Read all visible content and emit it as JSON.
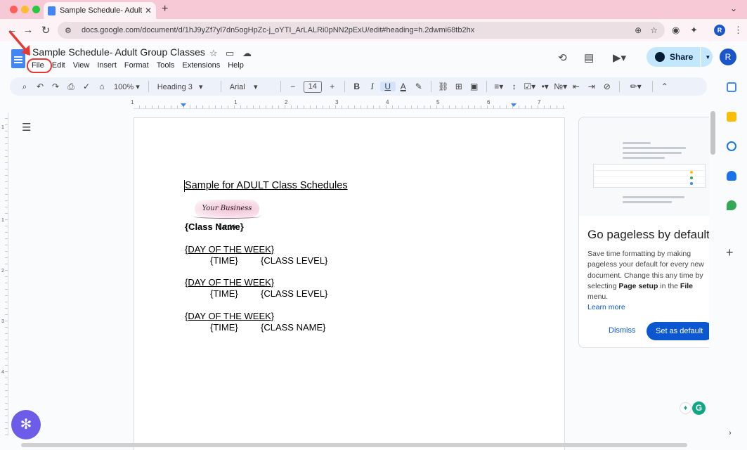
{
  "browser": {
    "tab_title": "Sample Schedule- Adult Grou",
    "tab_close": "✕",
    "new_tab": "+",
    "url": "docs.google.com/document/d/1hJ9yZf7yl7dn5ogHpZc-j_oYTI_ArLALRi0pNN2pExU/edit#heading=h.2dwmi68tb2hx",
    "profile_initial": "R"
  },
  "doc": {
    "title": "Sample Schedule- Adult Group Classes",
    "menu": [
      "File",
      "Edit",
      "View",
      "Insert",
      "Format",
      "Tools",
      "Extensions",
      "Help"
    ],
    "share_label": "Share",
    "account_initial": "R"
  },
  "toolbar": {
    "zoom": "100%",
    "style": "Heading 3",
    "font": "Arial",
    "font_size": "14",
    "bold": "B",
    "italic": "I",
    "underline": "U",
    "text_color": "A"
  },
  "ruler": {
    "marks": [
      "1",
      "1",
      "2",
      "3",
      "4",
      "5",
      "6",
      "7"
    ],
    "vmarks": [
      "1",
      "1",
      "2",
      "3",
      "4"
    ]
  },
  "content": {
    "heading": "Sample for ADULT Class Schedules",
    "logo_text": "Your Business Logo",
    "class_name": "{Class Name}",
    "blocks": [
      {
        "day": "{DAY OF THE WEEK}",
        "time": "{TIME}",
        "detail": "{CLASS LEVEL}"
      },
      {
        "day": "{DAY OF THE WEEK}",
        "time": "{TIME}",
        "detail": "{CLASS LEVEL}"
      },
      {
        "day": "{DAY OF THE WEEK}",
        "time": "{TIME}",
        "detail": "{CLASS NAME}"
      }
    ]
  },
  "side_panel": {
    "title": "Go pageless by default",
    "body_1": "Save time formatting by making pageless your default for every new document. Change this any time by selecting ",
    "body_bold_1": "Page setup",
    "body_2": " in the ",
    "body_bold_2": "File",
    "body_3": " menu.",
    "learn_more": "Learn more",
    "dismiss": "Dismiss",
    "set_default": "Set as default"
  },
  "colors": {
    "annotation_red": "#e53935",
    "docs_blue": "#4285f4",
    "share_bg": "#c2e7ff",
    "primary_button": "#0b57d0"
  }
}
